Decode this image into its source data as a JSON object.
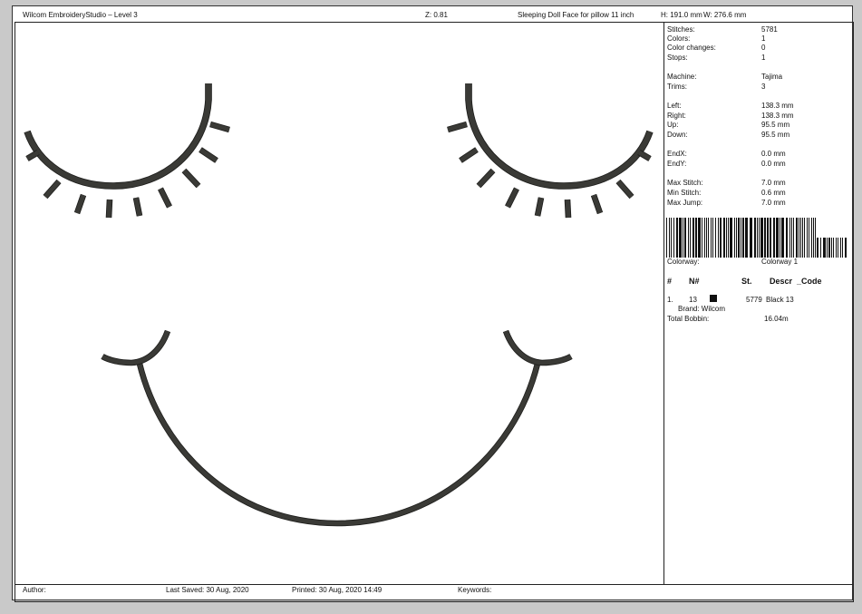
{
  "header": {
    "app_title": "Wilcom EmbroideryStudio – Level 3",
    "zoom": "Z: 0.81",
    "design_name": "Sleeping Doll Face for pillow 11 inch",
    "height": "H: 191.0 mm",
    "width": "W: 276.6 mm"
  },
  "stats": [
    {
      "label": "Stitches:",
      "value": "5781"
    },
    {
      "label": "Colors:",
      "value": "1"
    },
    {
      "label": "Color changes:",
      "value": "0"
    },
    {
      "label": "Stops:",
      "value": "1"
    },
    {
      "label": "Machine:",
      "value": "Tajima"
    },
    {
      "label": "Trims:",
      "value": "3"
    },
    {
      "label": "Left:",
      "value": "138.3 mm"
    },
    {
      "label": "Right:",
      "value": "138.3 mm"
    },
    {
      "label": "Up:",
      "value": "95.5 mm"
    },
    {
      "label": "Down:",
      "value": "95.5 mm"
    },
    {
      "label": "EndX:",
      "value": "0.0 mm"
    },
    {
      "label": "EndY:",
      "value": "0.0 mm"
    },
    {
      "label": "Max Stitch:",
      "value": "7.0 mm"
    },
    {
      "label": "Min Stitch:",
      "value": "0.6 mm"
    },
    {
      "label": "Max Jump:",
      "value": "7.0 mm"
    }
  ],
  "colorway": {
    "label": "Colorway:",
    "value": "Colorway 1"
  },
  "color_table": {
    "headers": [
      "#",
      "N#",
      "St.",
      "Descr",
      "Code"
    ],
    "rows": [
      {
        "index": "1.",
        "number": "13",
        "stitches": "5779",
        "description": "Black 13",
        "brand": "Brand: Wilcom",
        "swatch_color": "#111111"
      }
    ],
    "total_bobbin_label": "Total Bobbin:",
    "total_bobbin_value": "16.04m"
  },
  "footer": {
    "author": "Author:",
    "last_saved": "Last Saved: 30 Aug, 2020",
    "printed": "Printed: 30 Aug, 2020 14:49",
    "keywords": "Keywords:"
  },
  "colors": {
    "thread": "#3a3a36",
    "thread_edge": "#1c1c1a",
    "paper": "#ffffff",
    "background": "#c9c9c9"
  }
}
